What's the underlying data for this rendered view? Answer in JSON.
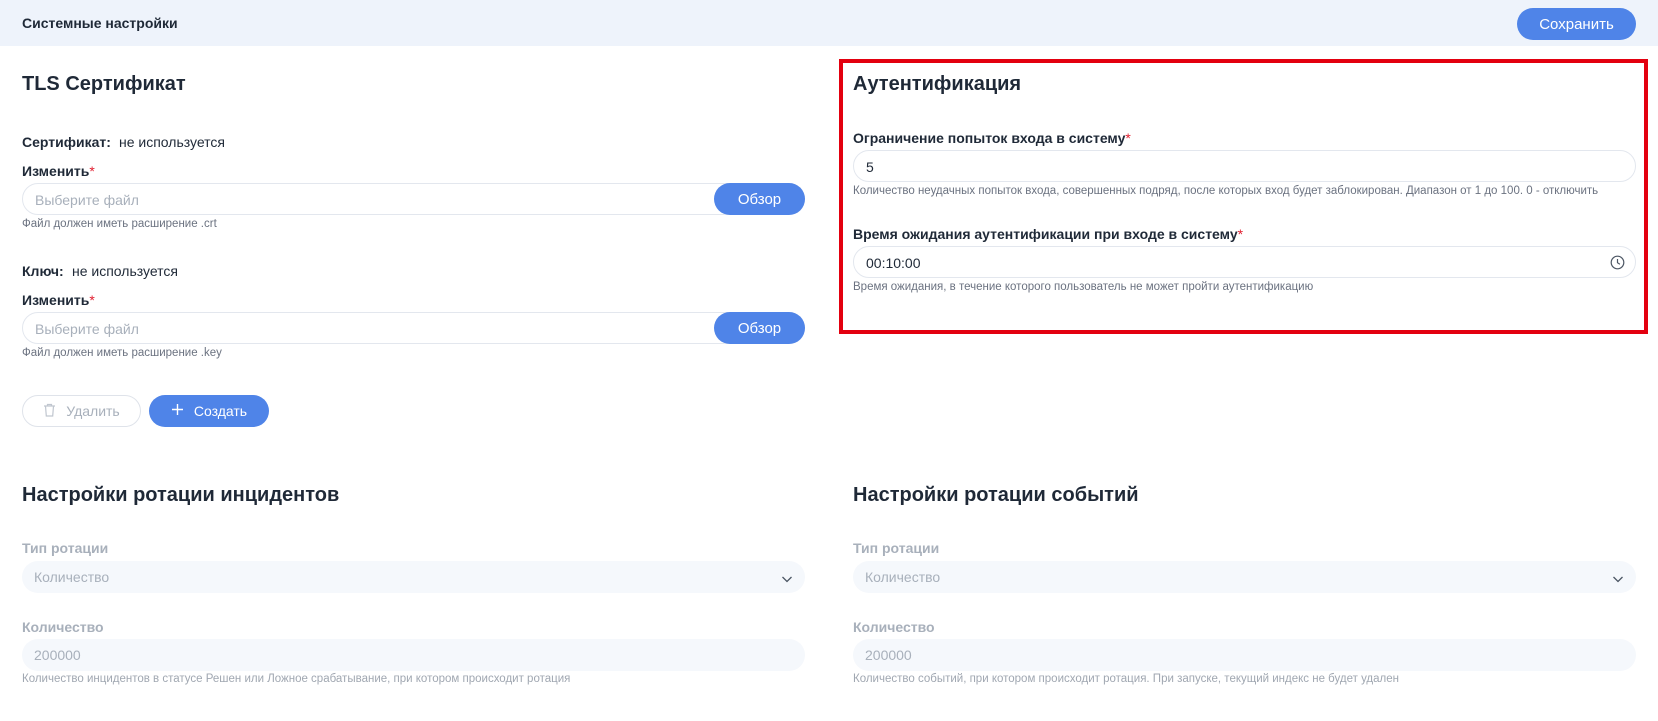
{
  "header": {
    "title": "Системные настройки",
    "save_label": "Сохранить"
  },
  "tls": {
    "title": "TLS Сертификат",
    "certificate": {
      "label": "Сертификат:",
      "value": "не используется",
      "change_label": "Изменить",
      "required_mark": "*",
      "placeholder": "Выберите файл",
      "browse_label": "Обзор",
      "hint": "Файл должен иметь расширение .crt"
    },
    "key": {
      "label": "Ключ:",
      "value": "не используется",
      "change_label": "Изменить",
      "required_mark": "*",
      "placeholder": "Выберите файл",
      "browse_label": "Обзор",
      "hint": "Файл должен иметь расширение .key"
    },
    "delete_label": "Удалить",
    "create_label": "Создать"
  },
  "auth": {
    "title": "Аутентификация",
    "attempts": {
      "label": "Ограничение попыток входа в систему",
      "required_mark": "*",
      "value": "5",
      "hint": "Количество неудачных попыток входа, совершенных подряд, после которых вход будет заблокирован. Диапазон от 1 до 100. 0 - отключить"
    },
    "timeout": {
      "label": "Время ожидания аутентификации при входе в систему",
      "required_mark": "*",
      "value": "00:10:00",
      "hint": "Время ожидания, в течение которого пользователь не может пройти аутентификацию"
    }
  },
  "incident_rotation": {
    "title": "Настройки ротации инцидентов",
    "type_label": "Тип ротации",
    "type_value": "Количество",
    "count_label": "Количество",
    "count_value": "200000",
    "hint": "Количество инцидентов в статусе Решен или Ложное срабатывание, при котором происходит ротация"
  },
  "event_rotation": {
    "title": "Настройки ротации событий",
    "type_label": "Тип ротации",
    "type_value": "Количество",
    "count_label": "Количество",
    "count_value": "200000",
    "hint": "Количество событий, при котором происходит ротация. При запуске, текущий индекс не будет удален"
  },
  "colors": {
    "accent": "#4f84e8",
    "highlight": "#e3000f",
    "required": "#e11d2e"
  },
  "icons": {
    "delete": "trash-icon",
    "create": "plus-icon",
    "time": "clock-icon",
    "select": "chevron-down-icon"
  }
}
